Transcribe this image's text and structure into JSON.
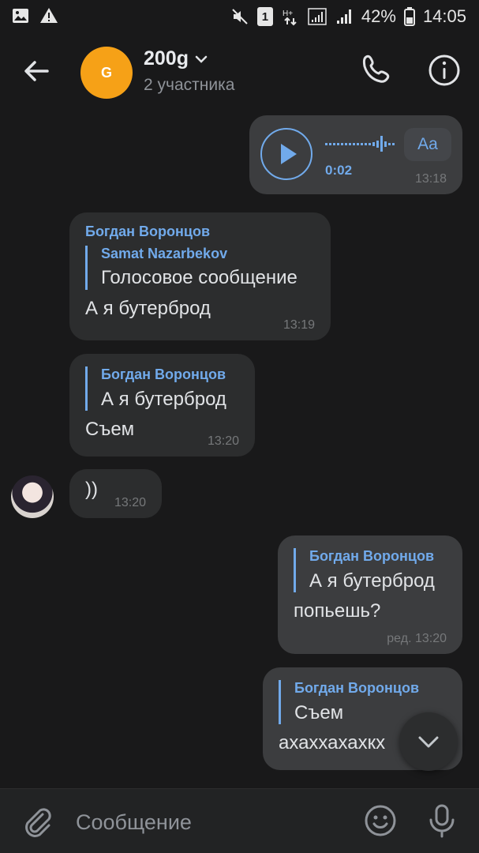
{
  "status_bar": {
    "battery_percent": "42%",
    "time": "14:05",
    "sim_badge": "1"
  },
  "header": {
    "avatar_letter": "G",
    "title": "200g",
    "subtitle": "2 участника"
  },
  "messages": [
    {
      "type": "voice",
      "duration": "0:02",
      "transcribe_label": "Aa",
      "time": "13:18"
    },
    {
      "sender": "Богдан Воронцов",
      "reply_name": "Samat Nazarbekov",
      "reply_text": "Голосовое сообщение",
      "text": "А я бутерброд",
      "time": "13:19"
    },
    {
      "reply_name": "Богдан Воронцов",
      "reply_text": "А я бутерброд",
      "text": "Съем",
      "time": "13:20"
    },
    {
      "text": "))",
      "time": "13:20"
    },
    {
      "reply_name": "Богдан Воронцов",
      "reply_text": "А я бутерброд",
      "text": "попьешь?",
      "time": "ред. 13:20"
    },
    {
      "reply_name": "Богдан Воронцов",
      "reply_text": "Съем",
      "text": "ахаххахахкх"
    }
  ],
  "composer": {
    "placeholder": "Сообщение"
  },
  "colors": {
    "background": "#19191a",
    "incoming_bubble": "#2c2d2e",
    "outgoing_bubble": "#3c3d3f",
    "accent": "#71aaeb",
    "avatar_orange": "#f6a117"
  }
}
